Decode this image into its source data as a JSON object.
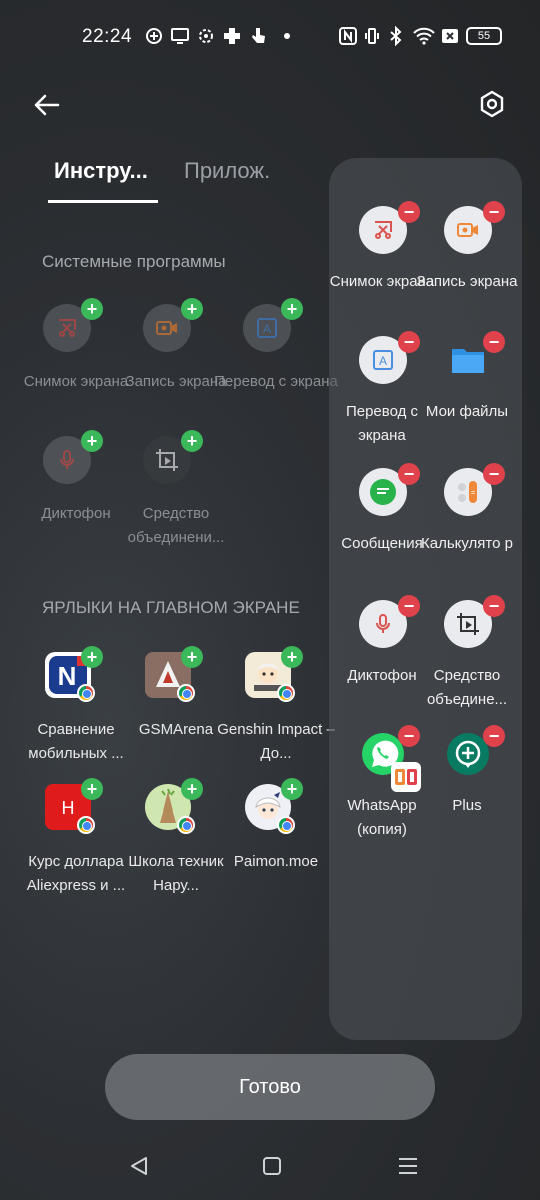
{
  "status_bar": {
    "time": "22:24",
    "battery": "55"
  },
  "tabs": [
    {
      "label": "Инстру..."
    },
    {
      "label": "Прилож."
    }
  ],
  "sections": {
    "system": "Системные программы",
    "shortcuts": "ЯРЛЫКИ НА ГЛАВНОМ ЭКРАНЕ"
  },
  "system_tools": [
    {
      "label": "Снимок экрана",
      "icon": "screenshot-icon"
    },
    {
      "label": "Запись экрана",
      "icon": "screen-record-icon"
    },
    {
      "label": "Перевод с экрана",
      "icon": "translate-icon"
    },
    {
      "label": "Диктофон",
      "icon": "microphone-icon"
    },
    {
      "label": "Средство объединени...",
      "icon": "crop-icon"
    }
  ],
  "shortcuts": [
    {
      "label": "Сравнение мобильных ...",
      "icon": "n-logo-icon"
    },
    {
      "label": "GSMArena",
      "icon": "gsmarena-icon"
    },
    {
      "label": "Genshin Impact – До...",
      "icon": "anime-avatar-icon"
    },
    {
      "label": "Курс доллара Aliexpress и ...",
      "icon": "h-red-icon"
    },
    {
      "label": "Школа техник Нару...",
      "icon": "hands-icon"
    },
    {
      "label": "Paimon.moe",
      "icon": "paimon-icon"
    }
  ],
  "panel": [
    {
      "label": "Снимок экрана",
      "icon": "screenshot-icon"
    },
    {
      "label": "Запись экрана",
      "icon": "screen-record-icon"
    },
    {
      "label": "Перевод с экрана",
      "icon": "translate-icon"
    },
    {
      "label": "Мои файлы",
      "icon": "folder-icon"
    },
    {
      "label": "Сообщения",
      "icon": "messages-icon"
    },
    {
      "label": "Калькулято р",
      "icon": "calculator-icon"
    },
    {
      "label": "Диктофон",
      "icon": "microphone-icon"
    },
    {
      "label": "Средство объедине...",
      "icon": "crop-icon"
    },
    {
      "label": "WhatsApp (копия)",
      "icon": "whatsapp-icon"
    },
    {
      "label": "Plus",
      "icon": "plus-chat-icon"
    }
  ],
  "done_label": "Готово",
  "colors": {
    "add": "#3bb85a",
    "remove": "#e0424b",
    "accent_red": "#d9534f",
    "accent_orange": "#f0883a",
    "accent_blue": "#4a8fe0"
  }
}
